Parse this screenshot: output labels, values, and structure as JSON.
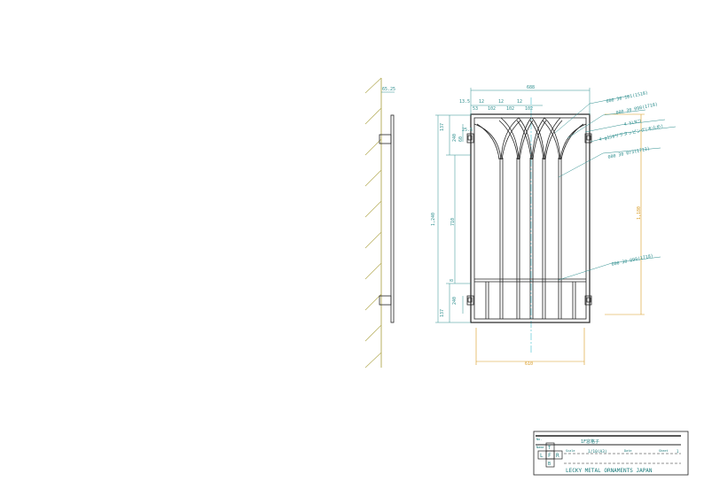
{
  "side_view": {
    "depth_top": "65.25"
  },
  "front_view": {
    "overall_width": "688",
    "top_offsets": [
      "13.5",
      "12",
      "12",
      "12"
    ],
    "bar_spacing": [
      "53",
      "102",
      "102",
      "102"
    ],
    "bottom_width": "610",
    "height_total": "1,240",
    "height_inner": "710",
    "height_top": "137",
    "height_bottom": "137",
    "height_bracket": "240",
    "bracket_top": "240",
    "right_height": "1,180",
    "small_60": "60",
    "small_8": "8",
    "small_25": "25.5"
  },
  "callouts": [
    "000 30 101(1518)",
    "000 30 098(1718)",
    "4 5LNコ",
    "4-φ150サラタッピング(木止め)",
    "000 30 073(1712)",
    "000 30 099(1718)"
  ],
  "title_block": {
    "row1_label": "No.",
    "row2_label": "Name",
    "name_value": "1F窓格子",
    "scale_label": "Scale",
    "scale_value": "1/10(A3)",
    "date_label": "Date",
    "sheet_label": "Sheet",
    "sheet_value": "1",
    "company": "LECKY METAL ORNAMENTS JAPAN",
    "view_letters": [
      "T",
      "L",
      "F",
      "R",
      "B"
    ]
  },
  "colors": {
    "line": "#222222",
    "dimension": "#2f8f8f",
    "wall_hatch": "#b8b060",
    "overall_dim": "#d89a20",
    "centerline": "#40c0d0"
  }
}
